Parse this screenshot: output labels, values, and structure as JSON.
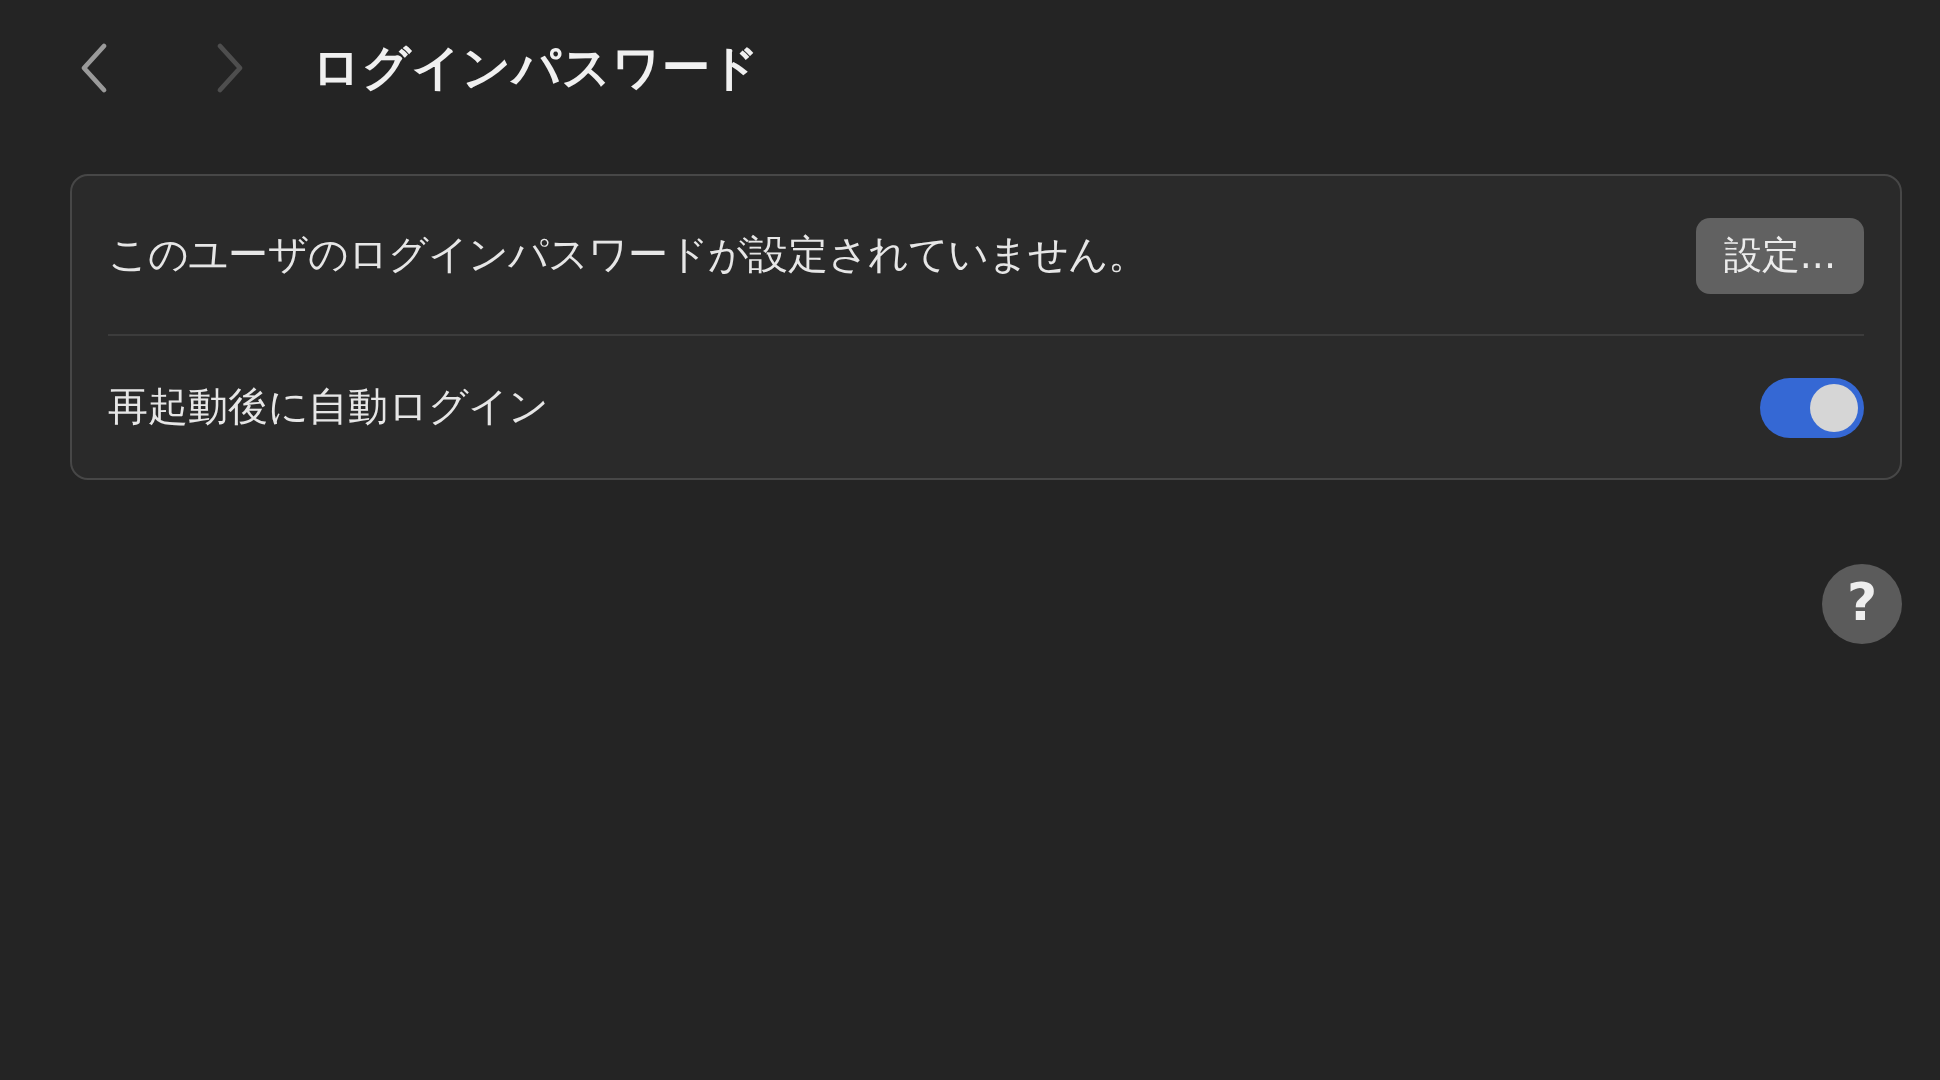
{
  "toolbar": {
    "back": {
      "disabled": false
    },
    "forward": {
      "disabled": true
    },
    "title": "ログインパスワード"
  },
  "rows": [
    {
      "kind": "button",
      "label": "このユーザのログインパスワードが設定されていません。",
      "button": "設定..."
    },
    {
      "kind": "toggle",
      "label": "再起動後に自動ログイン",
      "on": true
    }
  ],
  "help": "?"
}
